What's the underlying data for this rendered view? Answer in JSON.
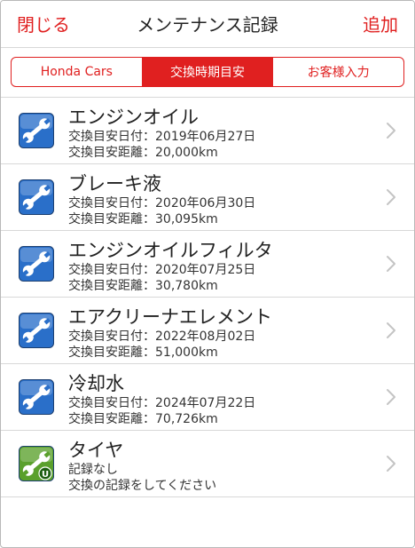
{
  "nav": {
    "close_label": "閉じる",
    "title": "メンテナンス記録",
    "add_label": "追加",
    "accent_color": "#e02020"
  },
  "segments": [
    {
      "label": "Honda Cars",
      "active": false
    },
    {
      "label": "交換時期目安",
      "active": true
    },
    {
      "label": "お客様入力",
      "active": false
    }
  ],
  "items": [
    {
      "title": "エンジンオイル",
      "line1": "交換目安日付：2019年06月27日",
      "line2": "交換目安距離：20,000km",
      "icon": "wrench-icon",
      "icon_color": "#2a6fc9"
    },
    {
      "title": "ブレーキ液",
      "line1": "交換目安日付：2020年06月30日",
      "line2": "交換目安距離：30,095km",
      "icon": "wrench-icon",
      "icon_color": "#2a6fc9"
    },
    {
      "title": "エンジンオイルフィルタ",
      "line1": "交換目安日付：2020年07月25日",
      "line2": "交換目安距離：30,780km",
      "icon": "wrench-icon",
      "icon_color": "#2a6fc9"
    },
    {
      "title": "エアクリーナエレメント",
      "line1": "交換目安日付：2022年08月02日",
      "line2": "交換目安距離：51,000km",
      "icon": "wrench-icon",
      "icon_color": "#2a6fc9"
    },
    {
      "title": "冷却水",
      "line1": "交換目安日付：2024年07月22日",
      "line2": "交換目安距離：70,726km",
      "icon": "wrench-icon",
      "icon_color": "#2a6fc9"
    },
    {
      "title": "タイヤ",
      "line1": "記録なし",
      "line2": "交換の記録をしてください",
      "icon": "wrench-user-icon",
      "icon_color": "#5aa02c",
      "badge": "U"
    }
  ]
}
